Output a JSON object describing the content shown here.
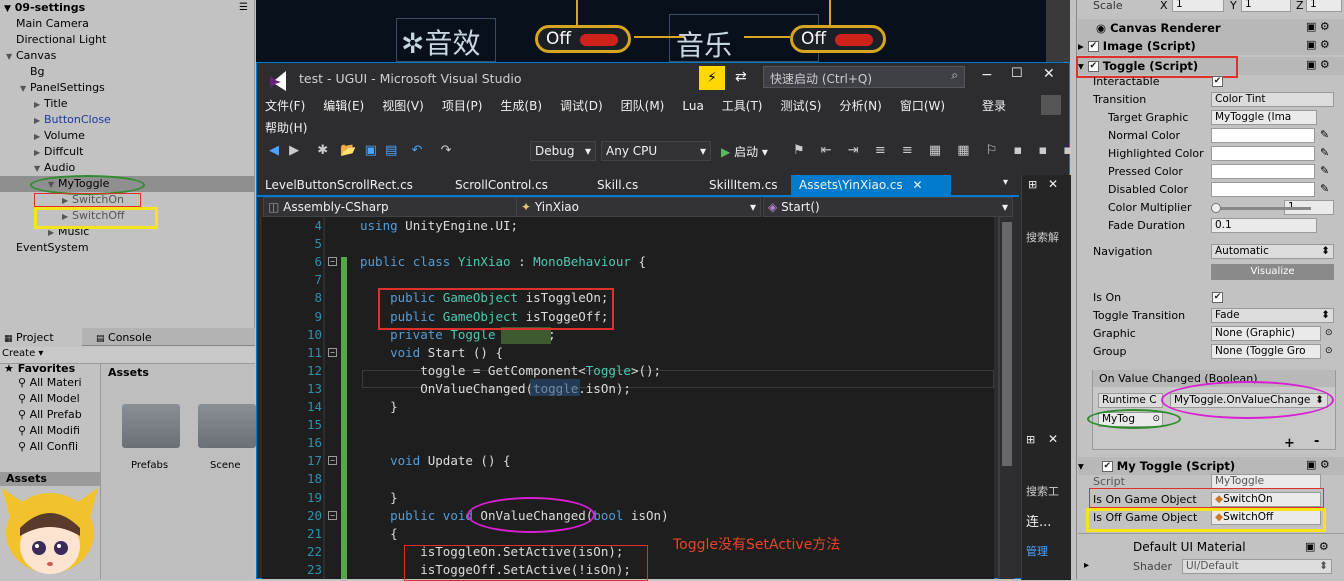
{
  "hierarchy": {
    "scene_name": "09-settings",
    "items": [
      {
        "label": "Main Camera",
        "indent": 0,
        "arrow": false
      },
      {
        "label": "Directional Light",
        "indent": 0,
        "arrow": false
      },
      {
        "label": "Canvas",
        "indent": 0,
        "arrow": true
      },
      {
        "label": "Bg",
        "indent": 1,
        "arrow": false
      },
      {
        "label": "PanelSettings",
        "indent": 1,
        "arrow": true
      },
      {
        "label": "Title",
        "indent": 2,
        "arrow": true
      },
      {
        "label": "ButtonClose",
        "indent": 2,
        "arrow": true
      },
      {
        "label": "Volume",
        "indent": 2,
        "arrow": true
      },
      {
        "label": "Diffcult",
        "indent": 2,
        "arrow": true
      },
      {
        "label": "Audio",
        "indent": 2,
        "arrow": true
      },
      {
        "label": "MyToggle",
        "indent": 3,
        "arrow": true
      },
      {
        "label": "SwitchOn",
        "indent": 4,
        "arrow": true
      },
      {
        "label": "SwitchOff",
        "indent": 4,
        "arrow": true
      },
      {
        "label": "Music",
        "indent": 3,
        "arrow": true
      },
      {
        "label": "EventSystem",
        "indent": 0,
        "arrow": false
      }
    ]
  },
  "project": {
    "tab_project": "Project",
    "tab_console": "Console",
    "create": "Create",
    "favorites": "Favorites",
    "fav_items": [
      "All Materi",
      "All Model",
      "All Prefab",
      "All Modifi",
      "All Confli"
    ],
    "assets_label": "Assets",
    "assets_section": "Assets",
    "folders": [
      "Prefabs",
      "Scene"
    ]
  },
  "scene": {
    "sound_label": "✲音效",
    "music_label": "音乐",
    "off1": "Off",
    "off2": "Off"
  },
  "vs": {
    "title": "test - UGUI - Microsoft Visual Studio",
    "quick_launch": "快速启动 (Ctrl+Q)",
    "menu": [
      "文件(F)",
      "编辑(E)",
      "视图(V)",
      "项目(P)",
      "生成(B)",
      "调试(D)",
      "团队(M)",
      "Lua",
      "工具(T)",
      "测试(S)",
      "分析(N)",
      "窗口(W)"
    ],
    "login": "登录",
    "help": "帮助(H)",
    "debug": "Debug",
    "cpu": "Any CPU",
    "start": "启动",
    "tabs": [
      "LevelButtonScrollRect.cs",
      "ScrollControl.cs",
      "Skill.cs",
      "SkillItem.cs",
      "Assets\\YinXiao.cs"
    ],
    "nav_project": "Assembly-CSharp",
    "nav_class": "YinXiao",
    "nav_method": "Start()",
    "side_search1": "搜索解",
    "side_search2": "搜索工",
    "side_connect": "连...",
    "side_manage": "管理",
    "annotation": "Toggle没有SetActive方法",
    "code_lines": [
      {
        "n": "4",
        "t": "using UnityEngine.UI;"
      },
      {
        "n": "5",
        "t": ""
      },
      {
        "n": "6",
        "t": "public class YinXiao : MonoBehaviour {"
      },
      {
        "n": "7",
        "t": ""
      },
      {
        "n": "8",
        "t": "    public GameObject isToggleOn;"
      },
      {
        "n": "9",
        "t": "    public GameObject isToggeOff;"
      },
      {
        "n": "10",
        "t": "    private Toggle toggle;"
      },
      {
        "n": "11",
        "t": "    void Start () {"
      },
      {
        "n": "12",
        "t": "        toggle = GetComponent<Toggle>();"
      },
      {
        "n": "13",
        "t": "        OnValueChanged(toggle.isOn);"
      },
      {
        "n": "14",
        "t": "    }"
      },
      {
        "n": "15",
        "t": ""
      },
      {
        "n": "16",
        "t": ""
      },
      {
        "n": "17",
        "t": "    void Update () {"
      },
      {
        "n": "18",
        "t": ""
      },
      {
        "n": "19",
        "t": "    }"
      },
      {
        "n": "20",
        "t": "    public void OnValueChanged(bool isOn)"
      },
      {
        "n": "21",
        "t": "    {"
      },
      {
        "n": "22",
        "t": "        isToggleOn.SetActive(isOn);"
      },
      {
        "n": "23",
        "t": "        isToggeOff.SetActive(!isOn);"
      }
    ]
  },
  "inspector": {
    "scale_label": "Scale",
    "scale_x": "1",
    "scale_y": "1",
    "scale_z": "1",
    "canvas_renderer": "Canvas Renderer",
    "image_script": "Image (Script)",
    "toggle_script": "Toggle (Script)",
    "rows": [
      {
        "label": "Interactable",
        "value": "✔"
      },
      {
        "label": "Transition",
        "value": "Color Tint"
      },
      {
        "label": "Target Graphic",
        "value": "MyToggle (Ima"
      },
      {
        "label": "Normal Color",
        "value": ""
      },
      {
        "label": "Highlighted Color",
        "value": ""
      },
      {
        "label": "Pressed Color",
        "value": ""
      },
      {
        "label": "Disabled Color",
        "value": ""
      },
      {
        "label": "Color Multiplier",
        "value": "1"
      },
      {
        "label": "Fade Duration",
        "value": "0.1"
      }
    ],
    "color_multiplier": 0.0,
    "navigation_label": "Navigation",
    "navigation_value": "Automatic",
    "visualize": "Visualize",
    "is_on_label": "Is On",
    "is_on_value": "✔",
    "toggle_transition_label": "Toggle Transition",
    "toggle_transition_value": "Fade",
    "graphic_label": "Graphic",
    "graphic_value": "None (Graphic)",
    "group_label": "Group",
    "group_value": "None (Toggle Gro",
    "event_header": "On Value Changed (Boolean)",
    "runtime": "Runtime C",
    "event_func": "MyToggle.OnValueChange",
    "event_obj": "MyTog",
    "plus": "+",
    "minus": "-",
    "my_toggle_script": "My Toggle (Script)",
    "script_label": "Script",
    "script_value": "MyToggle",
    "is_on_go_label": "Is On Game Object",
    "is_on_go_value": "SwitchOn",
    "is_off_go_label": "Is Off Game Object",
    "is_off_go_value": "SwitchOff",
    "material": "Default UI Material",
    "shader_label": "Shader",
    "shader_value": "UI/Default"
  },
  "colors": {
    "vs_accent": "#007acc",
    "highlight_red": "#e0302c",
    "highlight_yellow": "#f5e516",
    "ellipse_green": "#2e8b2e",
    "ellipse_magenta": "#d91fd1"
  }
}
